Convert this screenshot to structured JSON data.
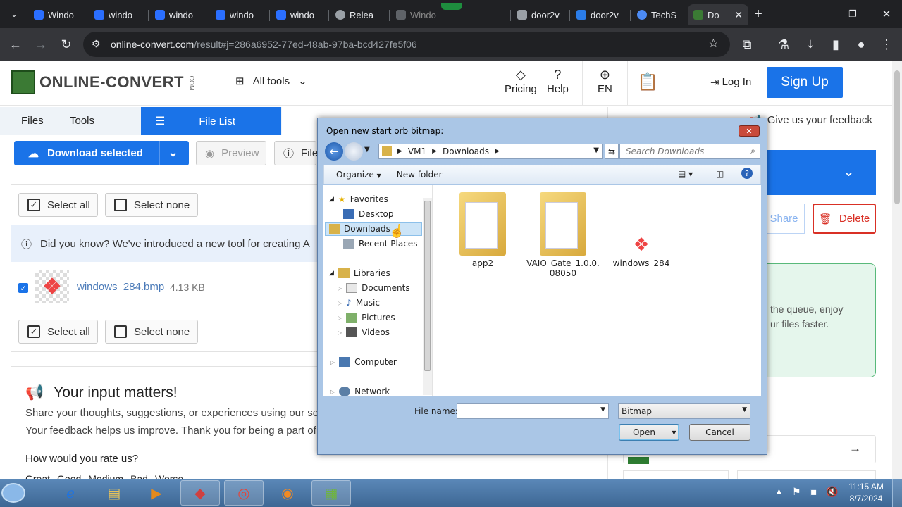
{
  "browser": {
    "tabs": [
      {
        "label": "Windo",
        "color": "#2b6fff"
      },
      {
        "label": "windo",
        "color": "#2b6fff"
      },
      {
        "label": "windo",
        "color": "#2b6fff"
      },
      {
        "label": "windo",
        "color": "#2b6fff"
      },
      {
        "label": "windo",
        "color": "#2b6fff"
      },
      {
        "label": "Relea",
        "color": "#9aa0a6"
      },
      {
        "label": "Windo",
        "color": "#5f6368"
      },
      {
        "label": "door2v",
        "color": "#9aa0a6"
      },
      {
        "label": "door2v",
        "color": "#2b7de9"
      },
      {
        "label": "TechS",
        "color": "#4c8bf5"
      },
      {
        "label": "Do",
        "color": "#3b7a34"
      }
    ],
    "url_host": "online-convert.com",
    "url_path": "/result#j=286a6952-77ed-48ab-97ba-bcd427fe5f06"
  },
  "site": {
    "logo_text": "ONLINE-CONVERT",
    "logo_suffix": ".COM",
    "all_tools": "All tools",
    "pricing": "Pricing",
    "help": "Help",
    "lang": "EN",
    "login": "Log In",
    "signup": "Sign Up",
    "tab_files": "Files",
    "tab_tools": "Tools",
    "tab_filelist": "File List",
    "feedback_link": "Give us your feedback",
    "download_selected": "Download selected",
    "preview": "Preview",
    "file_info": "File",
    "select_all": "Select all",
    "select_none": "Select none",
    "did_you_know": "Did you know? We've introduced a new tool for creating A",
    "file_name": "windows_284.bmp",
    "file_size": "4.13 KB",
    "share": "Share",
    "delete": "Delete",
    "queue_line1": "the queue, enjoy",
    "queue_line2": "ur files faster.",
    "input_matters": "Your input matters!",
    "input_p1": "Share your thoughts, suggestions, or experiences using our serv",
    "input_p2": "Your feedback helps us improve. Thank you for being a part of o",
    "rate_us": "How would you rate us?",
    "rating_options": [
      "Great",
      "Good",
      "Medium",
      "Bad",
      "Worse"
    ]
  },
  "dialog": {
    "title": "Open new start orb bitmap:",
    "path": [
      "VM1",
      "Downloads"
    ],
    "search_placeholder": "Search Downloads",
    "organize": "Organize",
    "new_folder": "New folder",
    "tree": {
      "favorites": "Favorites",
      "desktop": "Desktop",
      "downloads": "Downloads",
      "recent": "Recent Places",
      "libraries": "Libraries",
      "documents": "Documents",
      "music": "Music",
      "pictures": "Pictures",
      "videos": "Videos",
      "computer": "Computer",
      "network": "Network"
    },
    "files": [
      {
        "name": "app2"
      },
      {
        "name": "VAIO_Gate_1.0.0.\n08050"
      },
      {
        "name": "windows_284"
      }
    ],
    "file_name_label": "File name:",
    "file_name_value": "",
    "file_type": "Bitmap",
    "open": "Open",
    "cancel": "Cancel"
  },
  "taskbar": {
    "time": "11:15 AM",
    "date": "8/7/2024"
  }
}
